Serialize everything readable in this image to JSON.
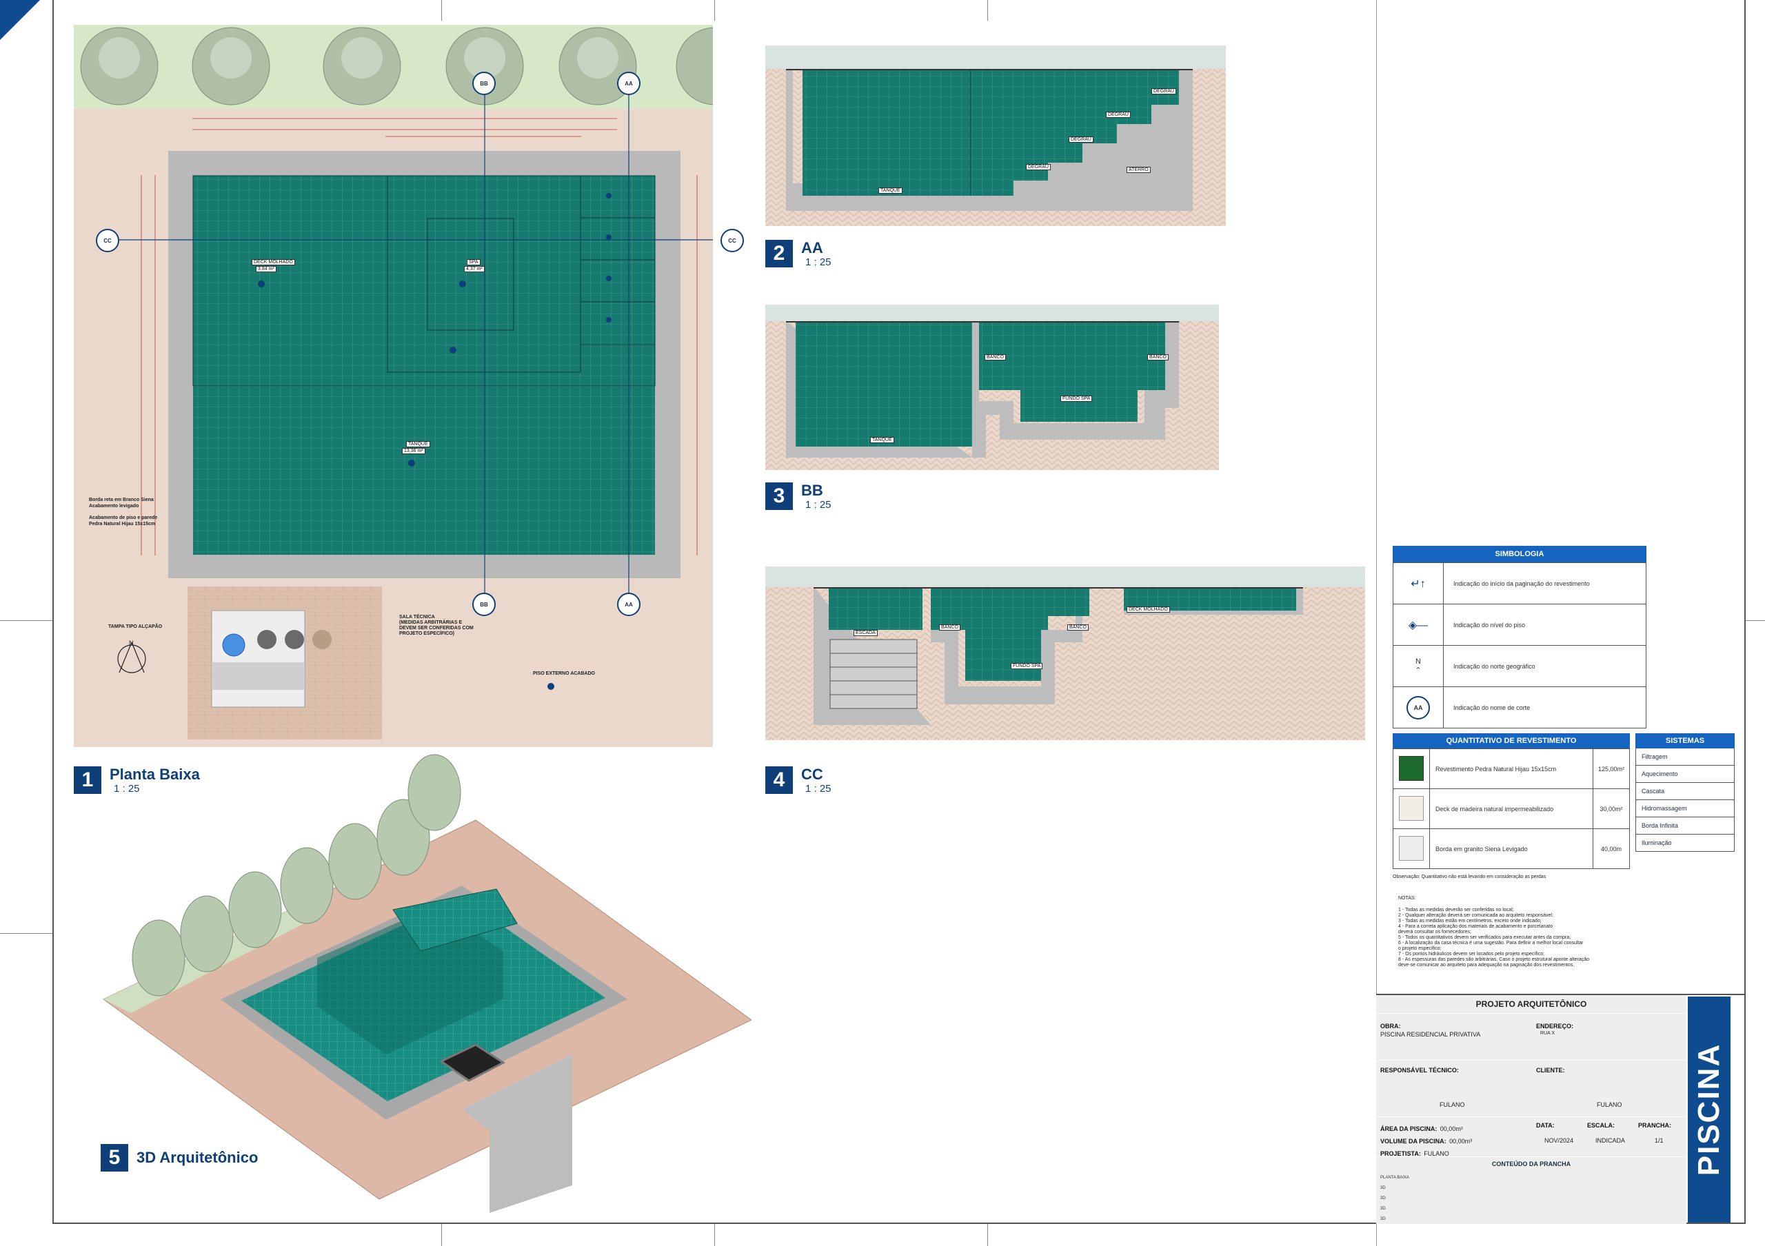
{
  "plan": {
    "view_number": "1",
    "view_title": "Planta Baixa",
    "scale": "1 : 25",
    "labels": {
      "deck": "DECK MOLHADO",
      "deck_area": "3,84 m²",
      "spa": "SPA",
      "spa_area": "4,37 m²",
      "tanque": "TANQUE",
      "tanque_area": "13,36 m²",
      "borda_note_1": "Borda reta em Branco Siena",
      "borda_note_2": "Acabamento levigado",
      "piso_note_1": "Acabamento de piso e parede",
      "piso_note_2": "Pedra Natural Hijau 15x15cm",
      "tampa": "TAMPA TIPO ALÇAPÃO",
      "sala_1": "SALA TÉCNICA",
      "sala_2": "(MEDIDAS ARBITRÁRIAS E",
      "sala_3": "DEVEM SER CONFERIDAS COM",
      "sala_4": "PROJETO ESPECÍFICO)",
      "piso_externo": "PISO EXTERNO ACABADO",
      "north": "N"
    },
    "section_markers": {
      "aa": "AA",
      "bb": "BB",
      "cc": "CC"
    }
  },
  "sections": {
    "aa": {
      "view_number": "2",
      "view_title": "AA",
      "scale": "1 : 25",
      "labels": {
        "tanque": "TANQUE",
        "aterro": "ATERRO",
        "degrau": "DEGRAU"
      }
    },
    "bb": {
      "view_number": "3",
      "view_title": "BB",
      "scale": "1 : 25",
      "labels": {
        "tanque": "TANQUE",
        "banco": "BANCO",
        "fundo_spa": "FUNDO SPA"
      }
    },
    "cc": {
      "view_number": "4",
      "view_title": "CC",
      "scale": "1 : 25",
      "labels": {
        "escada": "ESCADA",
        "banco": "BANCO",
        "fundo_spa": "FUNDO SPA",
        "deck": "DECK MOLHADO"
      }
    }
  },
  "view3d": {
    "view_number": "5",
    "view_title": "3D Arquitetônico"
  },
  "symbology": {
    "title": "SIMBOLOGIA",
    "items": [
      "Indicação do início da paginação do revestimento",
      "Indicação do nível do piso",
      "Indicação do norte geográfico",
      "Indicação do nome de corte"
    ],
    "north": "N",
    "cut": "AA"
  },
  "quantitative": {
    "title": "QUANTITATIVO DE REVESTIMENTO",
    "rows": [
      {
        "desc": "Revestimento Pedra Natural Hijau 15x15cm",
        "qty": "125,00m²",
        "swatch": "#1e6b2e"
      },
      {
        "desc": "Deck de madeira natural impermeabilizado",
        "qty": "30,00m²",
        "swatch": "#f2ede6"
      },
      {
        "desc": "Borda em granito Siena Levigado",
        "qty": "40,00m",
        "swatch": "#ececec"
      }
    ],
    "obs": "Observação: Quantitativo não está levando em consideração as perdas"
  },
  "systems": {
    "title": "SISTEMAS",
    "items": [
      "Filtragem",
      "Aquecimento",
      "Cascata",
      "Hidromassagem",
      "Borda Infinita",
      "Iluminação"
    ]
  },
  "notes": {
    "title": "NOTAS:",
    "lines": [
      "1 - Todas as medidas deverão ser conferidas no local;",
      "2 - Qualquer alteração deverá ser comunicada ao arquiteto responsável;",
      "3 - Todas as medidas estão em centímetros, exceto onde indicado;",
      "4 - Para a correta aplicação dos materiais de acabamento e porcelanato",
      "deverá consultar os fornecedores;",
      "5 - Todos os quantitativos devem ser verificados para executar antes da compra;",
      "6 - A localização da casa técnica é uma sugestão. Para definir a melhor local consultar",
      "o projeto específico;",
      "7 - Os pontos hidráulicos devem ser locados pelo projeto específico;",
      "8 - As espessuras das paredes são arbitrárias. Caso o projeto estrutural aponte alteração",
      "deve-se comunicar ao arquiteto para adequação na paginação dos revestimentos."
    ]
  },
  "title_block": {
    "header": "PROJETO ARQUITETÔNICO",
    "obra_label": "OBRA:",
    "obra": "PISCINA RESIDENCIAL PRIVATIVA",
    "endereco_label": "ENDEREÇO:",
    "endereco": "RUA X",
    "resp_label": "RESPONSÁVEL TÉCNICO:",
    "resp": "FULANO",
    "cliente_label": "CLIENTE:",
    "cliente": "FULANO",
    "area_label": "ÁREA DA PISCINA:",
    "area": "00,00m²",
    "volume_label": "VOLUME DA PISCINA:",
    "volume": "00,00m³",
    "projetista_label": "PROJETISTA:",
    "projetista": "FULANO",
    "data_label": "DATA:",
    "data": "NOV/2024",
    "escala_label": "ESCALA:",
    "escala": "INDICADA",
    "prancha_label": "PRANCHA:",
    "prancha": "1/1",
    "conteudo_label": "CONTEÚDO DA PRANCHA",
    "conteudo": [
      "PLANTA BAIXA",
      "3D",
      "3D",
      "3D",
      "3D"
    ],
    "sheet_name": "PISCINA"
  },
  "colors": {
    "pool": "#167a6e",
    "coping": "#b9b9b9",
    "terrain": "#ead8cc",
    "grass": "#d6e8c8",
    "accent": "#1565c0",
    "navy": "#0f3f78"
  }
}
